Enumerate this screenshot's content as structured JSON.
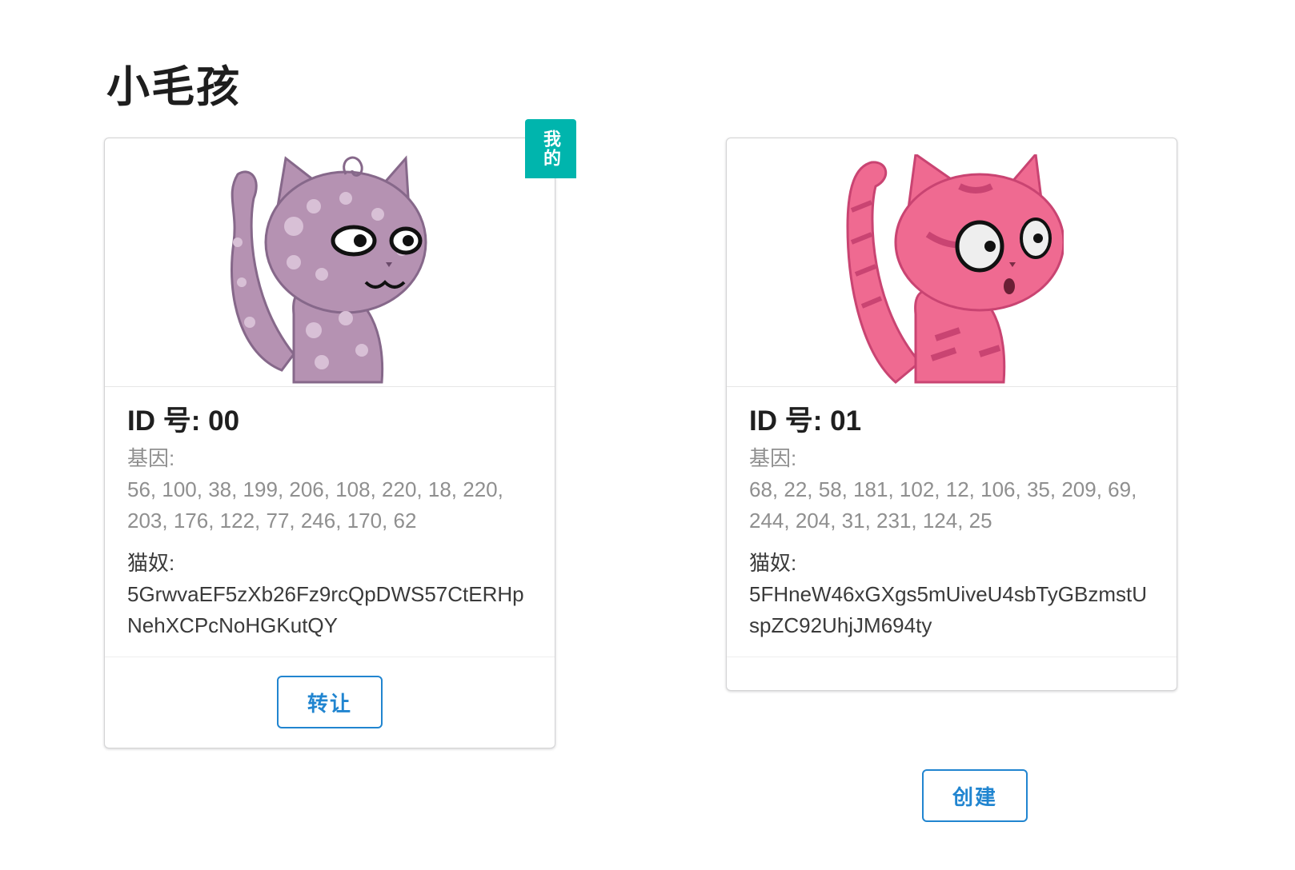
{
  "page": {
    "title": "小毛孩"
  },
  "cards": [
    {
      "mine_badge": "我的",
      "header": "ID 号: 00",
      "genes_label": "基因:",
      "genes": "56, 100, 38, 199, 206, 108, 220, 18, 220, 203, 176, 122, 77, 246, 170, 62",
      "owner_label": "猫奴:",
      "owner": "5GrwvaEF5zXb26Fz9rcQpDWS57CtERHpNehXCPcNoHGKutQY",
      "action_label": "转让",
      "cat_color": "#b592b2",
      "cat_icon": "spotted-cat-icon"
    },
    {
      "header": "ID 号: 01",
      "genes_label": "基因:",
      "genes": "68, 22, 58, 181, 102, 12, 106, 35, 209, 69, 244, 204, 31, 231, 124, 25",
      "owner_label": "猫奴:",
      "owner": "5FHneW46xGXgs5mUiveU4sbTyGBzmstUspZC92UhjJM694ty",
      "cat_color": "#ef6a91",
      "cat_icon": "striped-cat-icon"
    }
  ],
  "create_button": {
    "label": "创建"
  },
  "colors": {
    "badge": "#00b5ad",
    "button": "#2185d0"
  }
}
